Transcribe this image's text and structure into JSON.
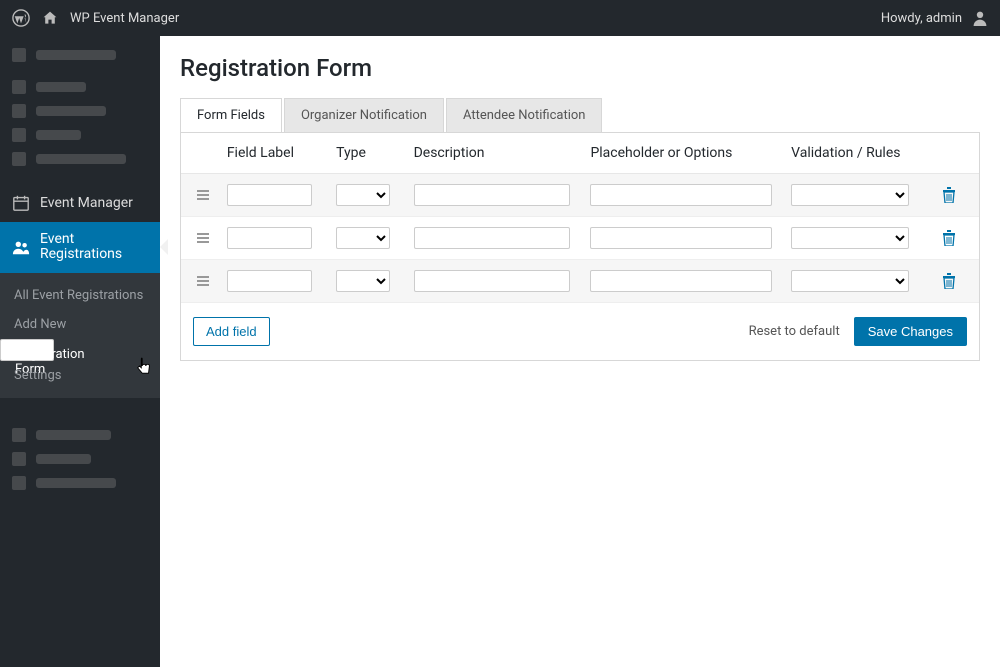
{
  "topbar": {
    "app": "WP Event Manager",
    "greeting": "Howdy, admin"
  },
  "sidebar": {
    "eventManager": "Event Manager",
    "eventRegistrations": "Event Registrations",
    "submenu": {
      "all": "All Event Registrations",
      "addNew": "Add New",
      "regForm": "Registration Form",
      "settings": "Settings"
    }
  },
  "page": {
    "title": "Registration Form"
  },
  "tabs": {
    "fields": "Form Fields",
    "orgNotif": "Organizer Notification",
    "attNotif": "Attendee Notification"
  },
  "headers": {
    "label": "Field Label",
    "type": "Type",
    "desc": "Description",
    "place": "Placeholder or Options",
    "valid": "Validation / Rules"
  },
  "rows": [
    {},
    {},
    {}
  ],
  "actions": {
    "add": "Add field",
    "reset": "Reset to default",
    "save": "Save Changes"
  }
}
